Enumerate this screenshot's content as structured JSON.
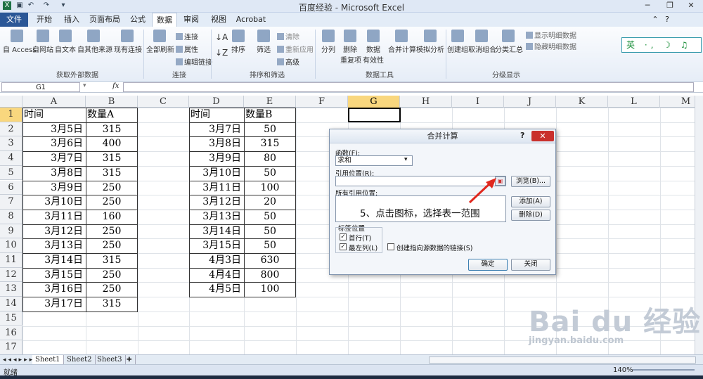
{
  "window": {
    "title": "百度经验 - Microsoft Excel"
  },
  "tabs": [
    {
      "label": "文件"
    },
    {
      "label": "开始"
    },
    {
      "label": "插入"
    },
    {
      "label": "页面布局"
    },
    {
      "label": "公式"
    },
    {
      "label": "数据"
    },
    {
      "label": "审阅"
    },
    {
      "label": "视图"
    },
    {
      "label": "Acrobat"
    }
  ],
  "ribbon": {
    "groups": {
      "external": "获取外部数据",
      "connections": "连接",
      "sortfilter": "排序和筛选",
      "datatools": "数据工具",
      "outline": "分级显示"
    },
    "btn": {
      "access": "自 Access",
      "web": "自网站",
      "text": "自文本",
      "other": "自其他来源",
      "existing": "现有连接",
      "refresh": "全部刷新",
      "conn": "连接",
      "props": "属性",
      "editlinks": "编辑链接",
      "sort": "排序",
      "filter": "筛选",
      "clear": "清除",
      "reapply": "重新应用",
      "advanced": "高级",
      "split": "分列",
      "dedupe": "删除",
      "dedupe2": "重复项",
      "validation": "数据",
      "validation2": "有效性",
      "consolidate": "合并计算",
      "whatif": "模拟分析",
      "group": "创建组",
      "ungroup": "取消组合",
      "subtotal": "分类汇总",
      "showdetail": "显示明细数据",
      "hidedetail": "隐藏明细数据"
    }
  },
  "ime": "英 ·, ☽ ♫",
  "formula": {
    "namebox": "G1",
    "fx": "fx",
    "value": ""
  },
  "columns": [
    "A",
    "B",
    "C",
    "D",
    "E",
    "F",
    "G",
    "H",
    "I",
    "J",
    "K",
    "L",
    "M"
  ],
  "rows": [
    "1",
    "2",
    "3",
    "4",
    "5",
    "6",
    "7",
    "8",
    "9",
    "10",
    "11",
    "12",
    "13",
    "14",
    "15",
    "16",
    "17"
  ],
  "table1": {
    "header": [
      "时间",
      "数量A"
    ],
    "rows": [
      [
        "3月5日",
        "315"
      ],
      [
        "3月6日",
        "400"
      ],
      [
        "3月7日",
        "315"
      ],
      [
        "3月8日",
        "315"
      ],
      [
        "3月9日",
        "250"
      ],
      [
        "3月10日",
        "250"
      ],
      [
        "3月11日",
        "160"
      ],
      [
        "3月12日",
        "250"
      ],
      [
        "3月13日",
        "250"
      ],
      [
        "3月14日",
        "315"
      ],
      [
        "3月15日",
        "250"
      ],
      [
        "3月16日",
        "250"
      ],
      [
        "3月17日",
        "315"
      ]
    ]
  },
  "table2": {
    "header": [
      "时间",
      "数量B"
    ],
    "rows": [
      [
        "3月7日",
        "50"
      ],
      [
        "3月8日",
        "315"
      ],
      [
        "3月9日",
        "80"
      ],
      [
        "3月10日",
        "50"
      ],
      [
        "3月11日",
        "100"
      ],
      [
        "3月12日",
        "20"
      ],
      [
        "3月13日",
        "50"
      ],
      [
        "3月14日",
        "50"
      ],
      [
        "3月15日",
        "50"
      ],
      [
        "4月3日",
        "630"
      ],
      [
        "4月4日",
        "800"
      ],
      [
        "4月5日",
        "100"
      ]
    ]
  },
  "dialog": {
    "title": "合并计算",
    "help": "?",
    "close": "✕",
    "function_label": "函数(F):",
    "function_value": "求和",
    "ref_label": "引用位置(R):",
    "browse": "浏览(B)...",
    "allrefs_label": "所有引用位置:",
    "add": "添加(A)",
    "delete": "删除(D)",
    "labels_group": "标签位置",
    "toprow": "首行(T)",
    "leftcol": "最左列(L)",
    "createlinks": "创建指向源数据的链接(S)",
    "ok": "确定",
    "cancel": "关闭"
  },
  "annotation": "5、点击图标，选择表一范围",
  "sheets": [
    "Sheet1",
    "Sheet2",
    "Sheet3"
  ],
  "status": {
    "ready": "就绪",
    "zoom": "140%"
  },
  "watermark": {
    "big": "Bai du 经验",
    "small": "jingyan.baidu.com"
  }
}
